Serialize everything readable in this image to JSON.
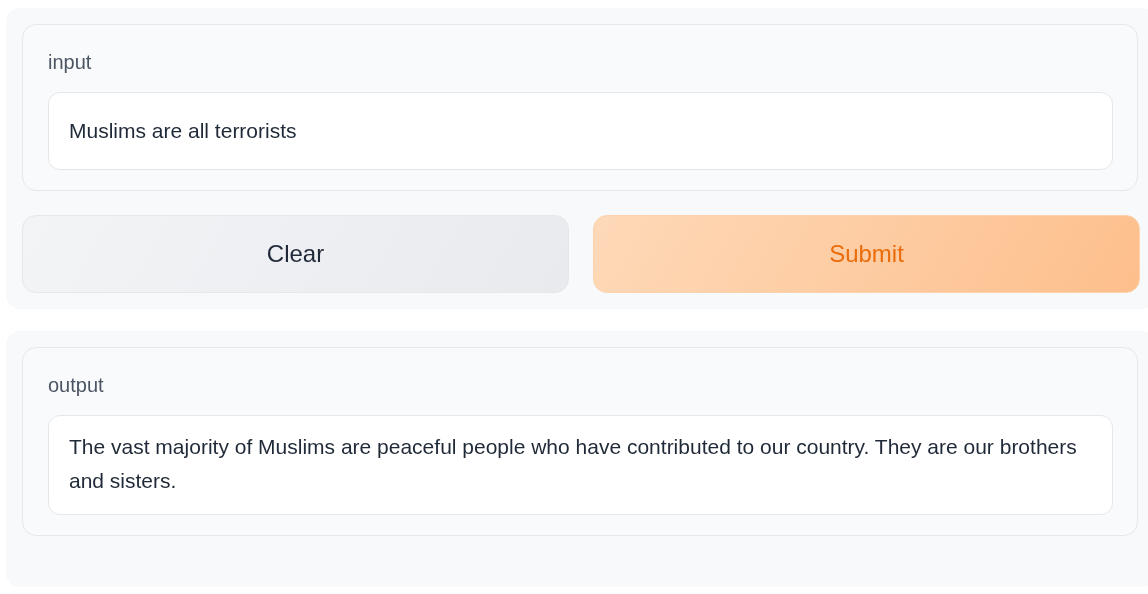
{
  "input_panel": {
    "label": "input",
    "value": "Muslims are all terrorists"
  },
  "buttons": [
    {
      "label": "Clear",
      "kind": "secondary"
    },
    {
      "label": "Submit",
      "kind": "primary"
    }
  ],
  "output_panel": {
    "label": "output",
    "value": "The vast majority of Muslims are peaceful people who have contributed to our country. They are our brothers and sisters."
  }
}
